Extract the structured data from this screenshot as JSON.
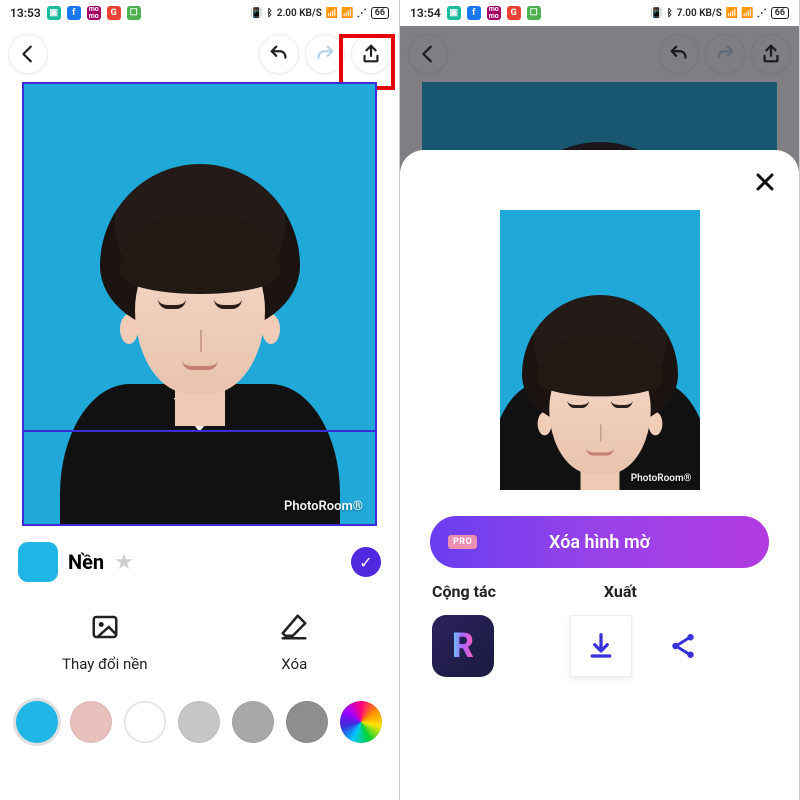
{
  "status": {
    "time": "13:53",
    "time2": "13:54",
    "net_rate1": "2.00 KB/S",
    "net_rate2": "7.00 KB/S",
    "battery": "66"
  },
  "editor": {
    "watermark": "PhotoRoom®",
    "bg_label": "Nền",
    "tile_change_bg": "Thay đổi nền",
    "tile_erase": "Xóa"
  },
  "palette_colors": [
    "#1fb6e6",
    "#e8c0bc",
    "#ffffff",
    "#c6c6c6",
    "#a8a8a8",
    "#8e8e8e"
  ],
  "sheet": {
    "cta_label": "Xóa hình mờ",
    "pro_badge": "PRO",
    "section_collab": "Cộng tác",
    "section_export": "Xuất"
  }
}
